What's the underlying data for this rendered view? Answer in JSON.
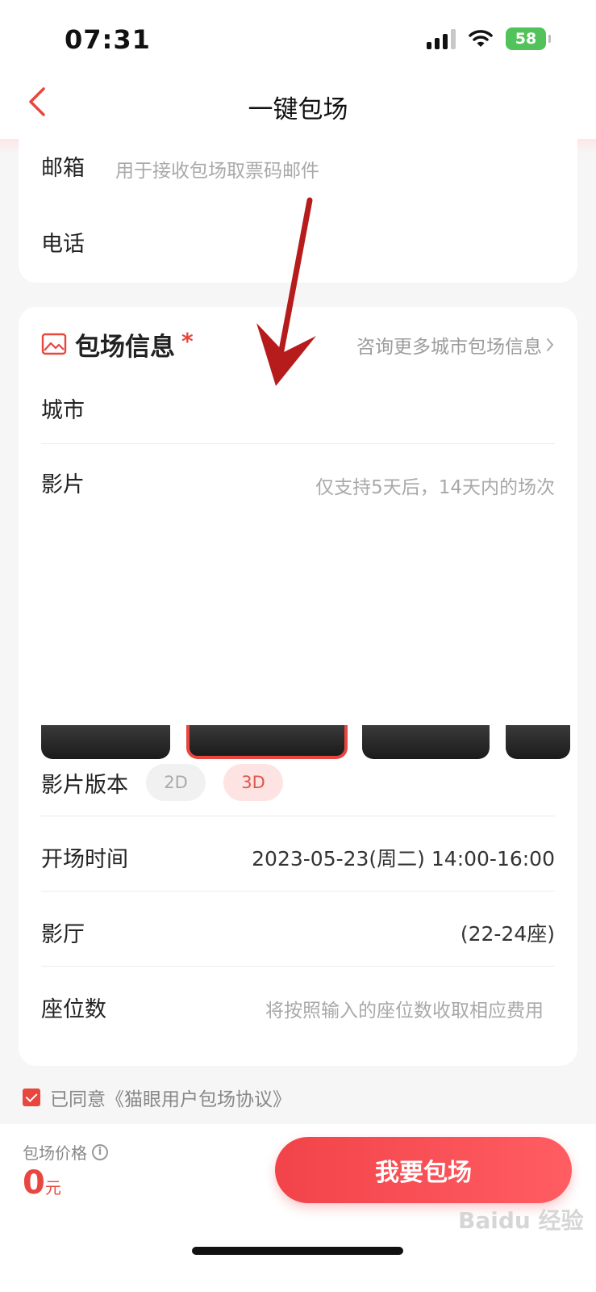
{
  "status_bar": {
    "time": "07:31",
    "battery": "58"
  },
  "nav": {
    "title": "一键包场"
  },
  "contact": {
    "email_label": "邮箱",
    "email_placeholder": "用于接收包场取票码邮件",
    "phone_label": "电话"
  },
  "charter_info": {
    "title": "包场信息",
    "required_mark": "*",
    "more_link": "咨询更多城市包场信息",
    "city_label": "城市",
    "movie_label": "影片",
    "movie_hint": "仅支持5天后，14天内的场次",
    "version_label": "影片版本",
    "versions": [
      "2D",
      "3D"
    ],
    "selected_version": "3D",
    "showtime_label": "开场时间",
    "showtime_value": "2023-05-23(周二) 14:00-16:00",
    "hall_label": "影厅",
    "hall_value": "(22-24座)",
    "seats_label": "座位数",
    "seats_hint": "将按照输入的座位数收取相应费用"
  },
  "agreement": {
    "text": "已同意《猫眼用户包场协议》",
    "checked": true
  },
  "footer": {
    "price_label": "包场价格",
    "price_value": "0",
    "price_unit": "元",
    "cta": "我要包场"
  },
  "colors": {
    "accent": "#e8463f",
    "cta": "#f2434a"
  }
}
